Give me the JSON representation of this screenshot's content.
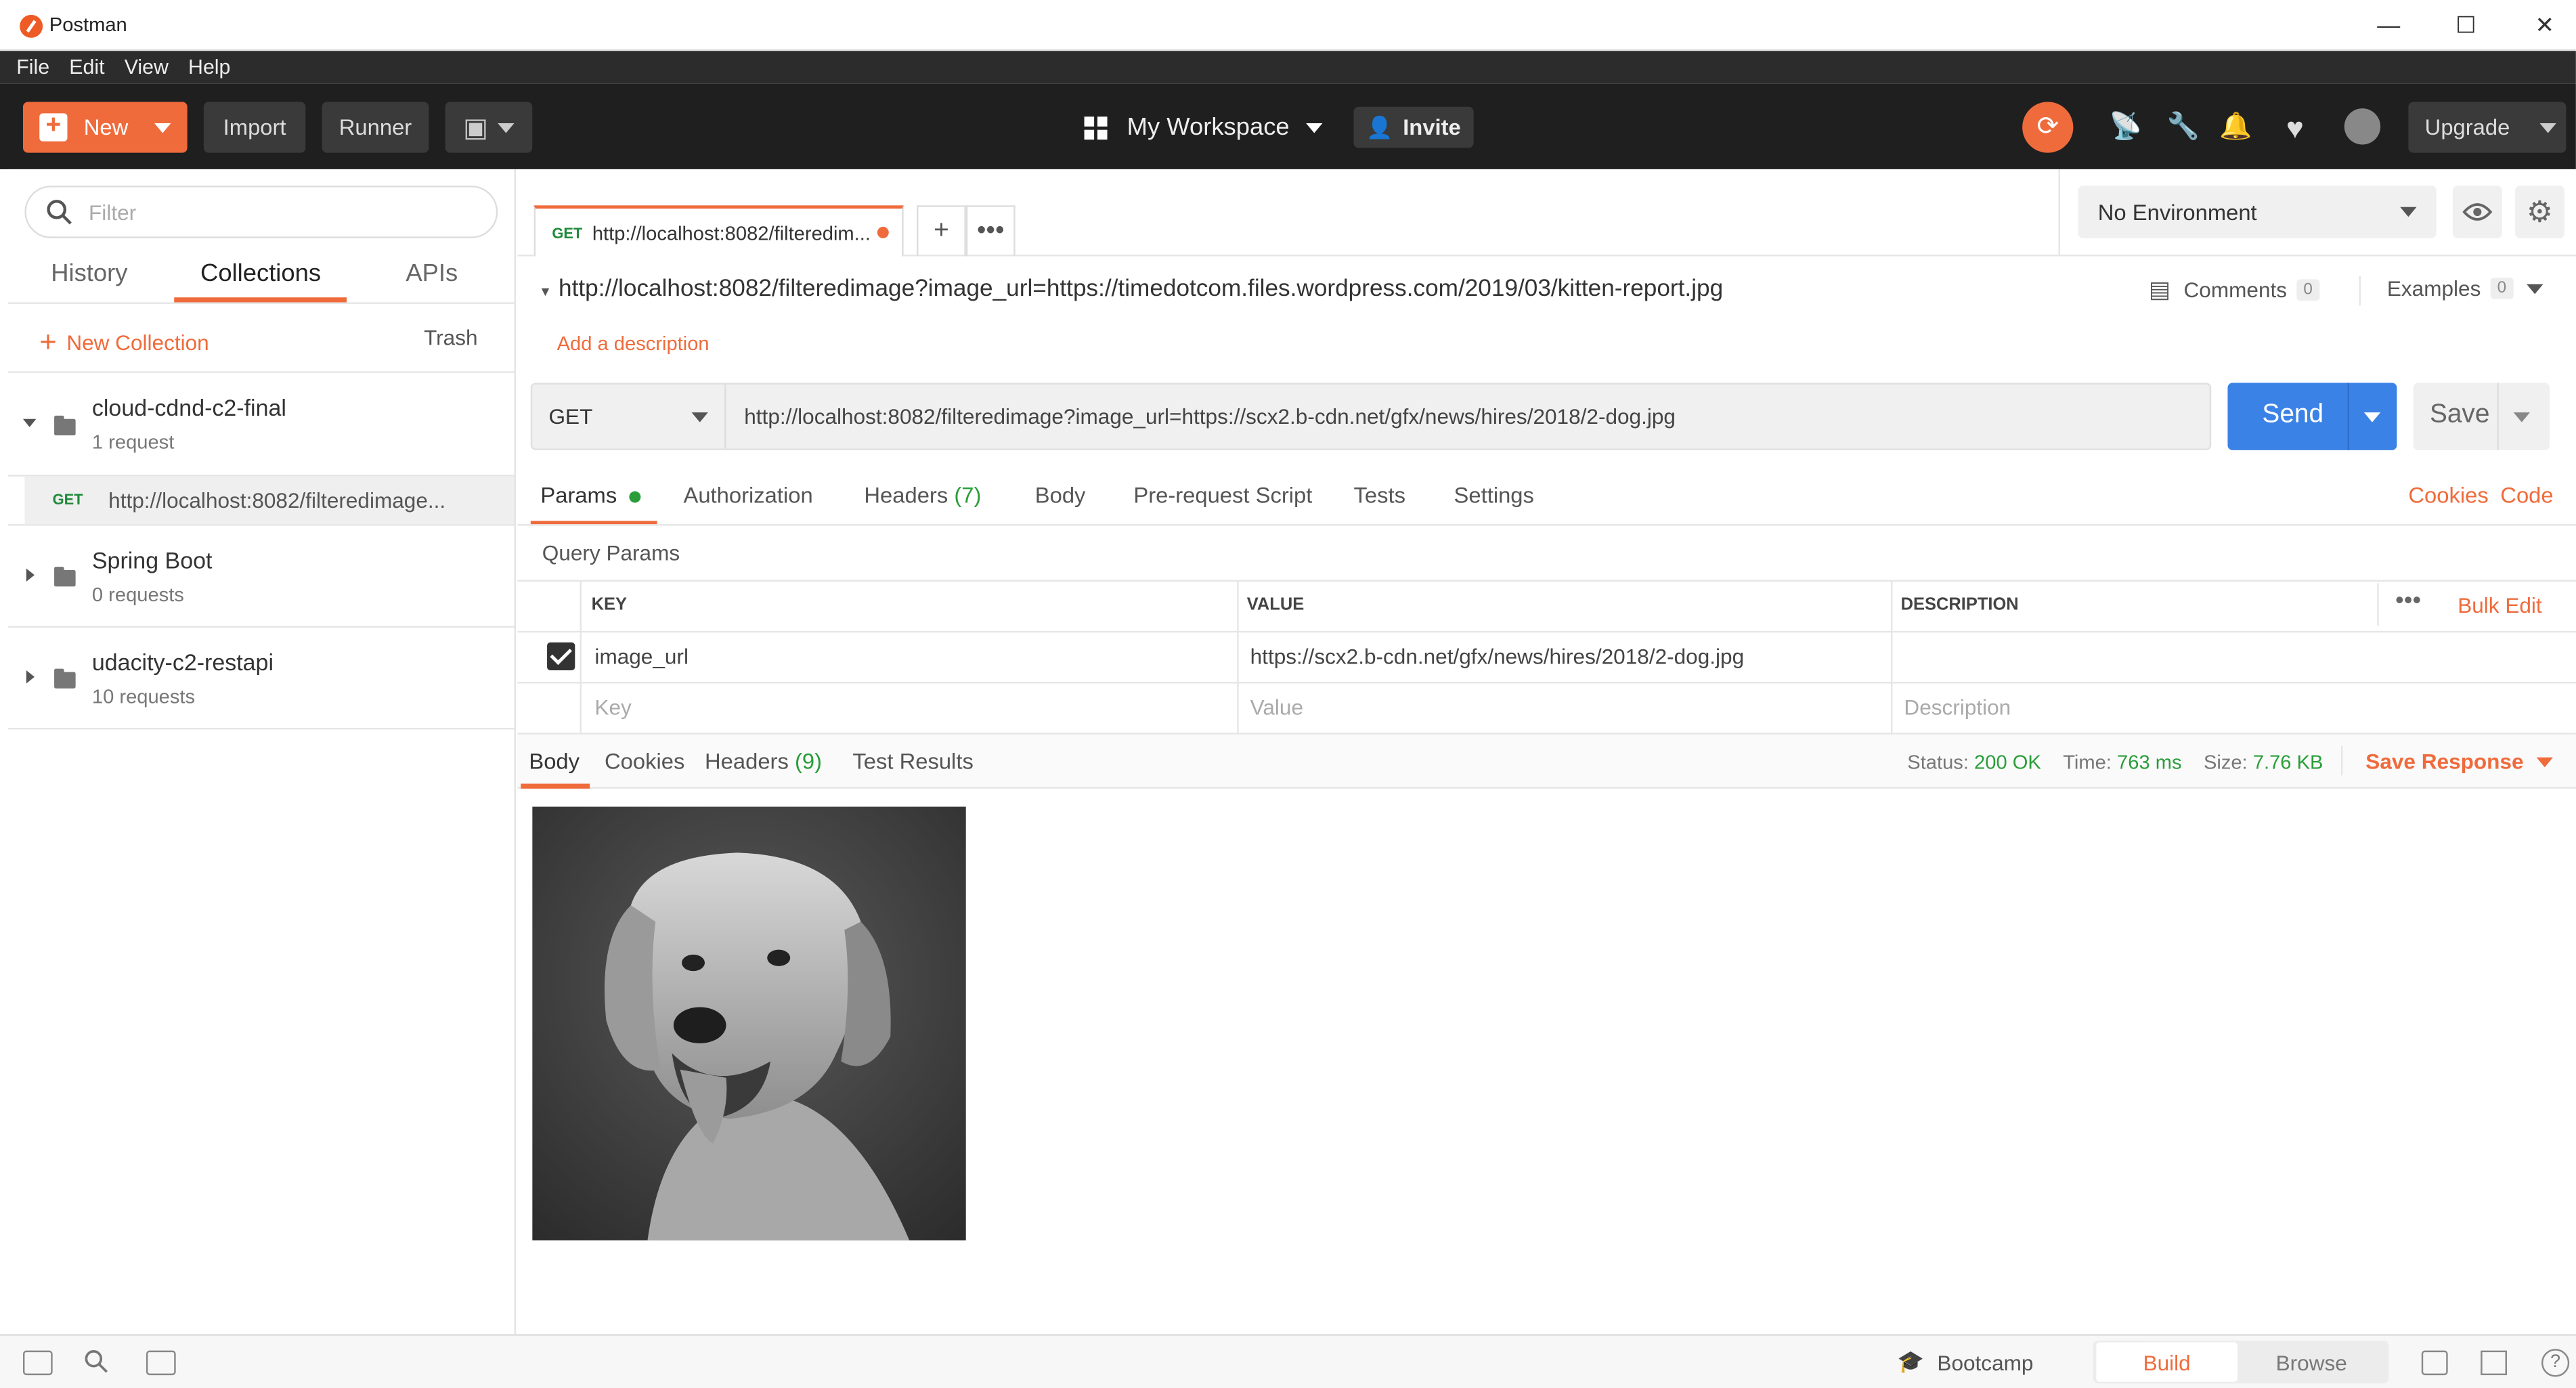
{
  "window": {
    "title": "Postman",
    "minimize": "—",
    "maximize": "☐",
    "close": "✕"
  },
  "menu": [
    "File",
    "Edit",
    "View",
    "Help"
  ],
  "header": {
    "new_label": "New",
    "import_label": "Import",
    "runner_label": "Runner",
    "workspace_label": "My Workspace",
    "invite_label": "Invite",
    "upgrade_label": "Upgrade",
    "accent": "#ef6b3c"
  },
  "sidebar": {
    "filter_placeholder": "Filter",
    "tabs": [
      "History",
      "Collections",
      "APIs"
    ],
    "new_collection_label": "New Collection",
    "trash_label": "Trash",
    "collections": [
      {
        "name": "cloud-cdnd-c2-final",
        "sub": "1 request"
      },
      {
        "name": "Spring Boot",
        "sub": "0 requests"
      },
      {
        "name": "udacity-c2-restapi",
        "sub": "10 requests"
      }
    ],
    "request_item": {
      "method": "GET",
      "url": "http://localhost:8082/filteredimage..."
    }
  },
  "main": {
    "tab": {
      "method": "GET",
      "title": "http://localhost:8082/filteredim..."
    },
    "environment": "No Environment",
    "request_name": "http://localhost:8082/filteredimage?image_url=https://timedotcom.files.wordpress.com/2019/03/kitten-report.jpg",
    "comments_label": "Comments",
    "comments_count": "0",
    "examples_label": "Examples",
    "examples_count": "0",
    "add_description": "Add a description",
    "method": "GET",
    "url": "http://localhost:8082/filteredimage?image_url=https://scx2.b-cdn.net/gfx/news/hires/2018/2-dog.jpg",
    "send_label": "Send",
    "save_label": "Save",
    "request_tabs": {
      "params": "Params",
      "authorization": "Authorization",
      "headers": "Headers",
      "headers_count": "(7)",
      "body": "Body",
      "prerequest": "Pre-request Script",
      "tests": "Tests",
      "settings": "Settings",
      "cookies": "Cookies",
      "code": "Code"
    },
    "query_params_title": "Query Params",
    "table": {
      "headers": [
        "KEY",
        "VALUE",
        "DESCRIPTION"
      ],
      "bulk_edit": "Bulk Edit",
      "row": {
        "key": "image_url",
        "value": "https://scx2.b-cdn.net/gfx/news/hires/2018/2-dog.jpg",
        "description": ""
      },
      "placeholders": {
        "key": "Key",
        "value": "Value",
        "description": "Description"
      }
    },
    "response": {
      "tabs": {
        "body": "Body",
        "cookies": "Cookies",
        "headers": "Headers",
        "headers_count": "(9)",
        "test_results": "Test Results"
      },
      "status_label": "Status:",
      "status_value": "200 OK",
      "time_label": "Time:",
      "time_value": "763 ms",
      "size_label": "Size:",
      "size_value": "7.76 KB",
      "save_response": "Save Response"
    }
  },
  "footer": {
    "bootcamp": "Bootcamp",
    "build": "Build",
    "browse": "Browse"
  }
}
